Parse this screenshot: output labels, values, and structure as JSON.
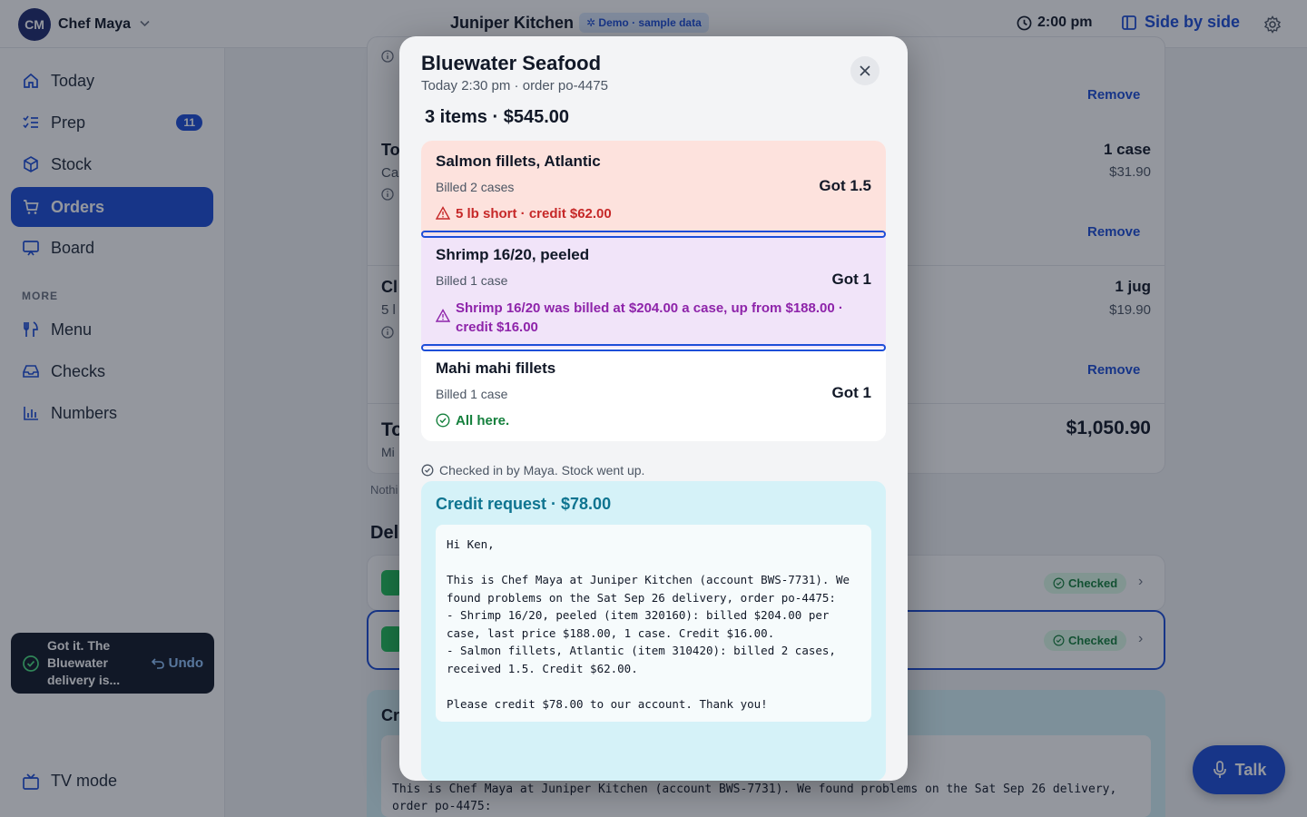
{
  "user": {
    "initials": "CM",
    "name": "Chef Maya"
  },
  "header": {
    "title": "Juniper Kitchen",
    "demo_badge": "Demo · sample data",
    "time": "2:00 pm",
    "side_by_side": "Side by side"
  },
  "sidebar": {
    "items": [
      {
        "label": "Today"
      },
      {
        "label": "Prep",
        "badge": "11"
      },
      {
        "label": "Stock"
      },
      {
        "label": "Orders"
      },
      {
        "label": "Board"
      }
    ],
    "more_label": "MORE",
    "more_items": [
      {
        "label": "Menu"
      },
      {
        "label": "Checks"
      },
      {
        "label": "Numbers"
      }
    ],
    "tv_mode": "TV mode"
  },
  "toast": {
    "text": "Got it. The Bluewater delivery is...",
    "undo": "Undo"
  },
  "background": {
    "remove": "Remove",
    "rows": [
      {
        "qty": "1 case",
        "price": "$31.90"
      },
      {
        "qty": "1 jug",
        "price": "$19.90"
      }
    ],
    "total": "$1,050.90",
    "checked": "Checked",
    "partial_labels": {
      "to1": "To",
      "ca": "Ca",
      "cl": "Cl",
      "five": "5 l",
      "to2": "To",
      "mi": "Mi",
      "nothing": "Nothi",
      "del": "Del",
      "cr": "Cr"
    },
    "email_line1": "This is Chef Maya at Juniper Kitchen (account BWS-7731). We found problems on the Sat Sep 26 delivery,",
    "email_line2": "order po-4475:",
    "talk": "Talk"
  },
  "modal": {
    "title": "Bluewater Seafood",
    "subtitle": "Today 2:30 pm · order po-4475",
    "summary": "3 items · $545.00",
    "items": [
      {
        "name": "Salmon fillets, Atlantic",
        "billed": "Billed 2 cases",
        "got": "Got 1.5",
        "note": "5 lb short · credit $62.00"
      },
      {
        "name": "Shrimp 16/20, peeled",
        "billed": "Billed 1 case",
        "got": "Got 1",
        "note": "Shrimp 16/20 was billed at $204.00 a case, up from $188.00 · credit $16.00"
      },
      {
        "name": "Mahi mahi fillets",
        "billed": "Billed 1 case",
        "got": "Got 1",
        "note": "All here."
      }
    ],
    "checked_in": "Checked in by Maya. Stock went up.",
    "credit_title": "Credit request · $78.00",
    "email": "Hi Ken,\n\nThis is Chef Maya at Juniper Kitchen (account BWS-7731). We found problems on the Sat Sep 26 delivery, order po-4475:\n- Shrimp 16/20, peeled (item 320160): billed $204.00 per case, last price $188.00, 1 case. Credit $16.00.\n- Salmon fillets, Atlantic (item 310420): billed 2 cases, received 1.5. Credit $62.00.\n\nPlease credit $78.00 to our account. Thank you!"
  },
  "colors": {
    "accent": "#1d4ed8",
    "short_red": "#c62828",
    "price_purple": "#8e24aa",
    "ok_green": "#15803d",
    "credit_teal": "#0e7490"
  }
}
